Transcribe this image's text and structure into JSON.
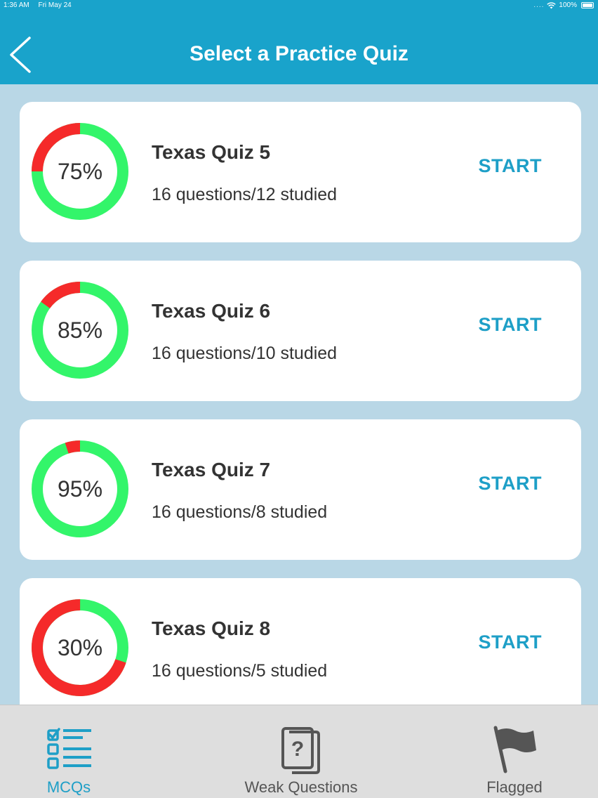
{
  "status_bar": {
    "time": "1:36 AM",
    "date": "Fri May 24",
    "dots": "....",
    "battery": "100%"
  },
  "header": {
    "title": "Select a Practice Quiz"
  },
  "quizzes": [
    {
      "title": "Texas Quiz 5",
      "subtitle": "16 questions/12 studied",
      "percent_label": "75%",
      "percent": 75,
      "action": "START"
    },
    {
      "title": "Texas Quiz 6",
      "subtitle": "16 questions/10 studied",
      "percent_label": "85%",
      "percent": 85,
      "action": "START"
    },
    {
      "title": "Texas Quiz 7",
      "subtitle": "16 questions/8 studied",
      "percent_label": "95%",
      "percent": 95,
      "action": "START"
    },
    {
      "title": "Texas Quiz 8",
      "subtitle": "16 questions/5 studied",
      "percent_label": "30%",
      "percent": 30,
      "action": "START"
    }
  ],
  "tabs": [
    {
      "label": "MCQs",
      "icon": "checklist-icon",
      "active": true
    },
    {
      "label": "Weak Questions",
      "icon": "question-card-icon",
      "active": false
    },
    {
      "label": "Flagged",
      "icon": "flag-icon",
      "active": false
    }
  ],
  "colors": {
    "header": "#19a3cb",
    "background": "#b9d7e6",
    "ring_green": "#33f56a",
    "ring_red": "#f52a2a",
    "accent": "#1e9fc7",
    "tab_active": "#1e9fc7",
    "tab_inactive": "#555555"
  }
}
